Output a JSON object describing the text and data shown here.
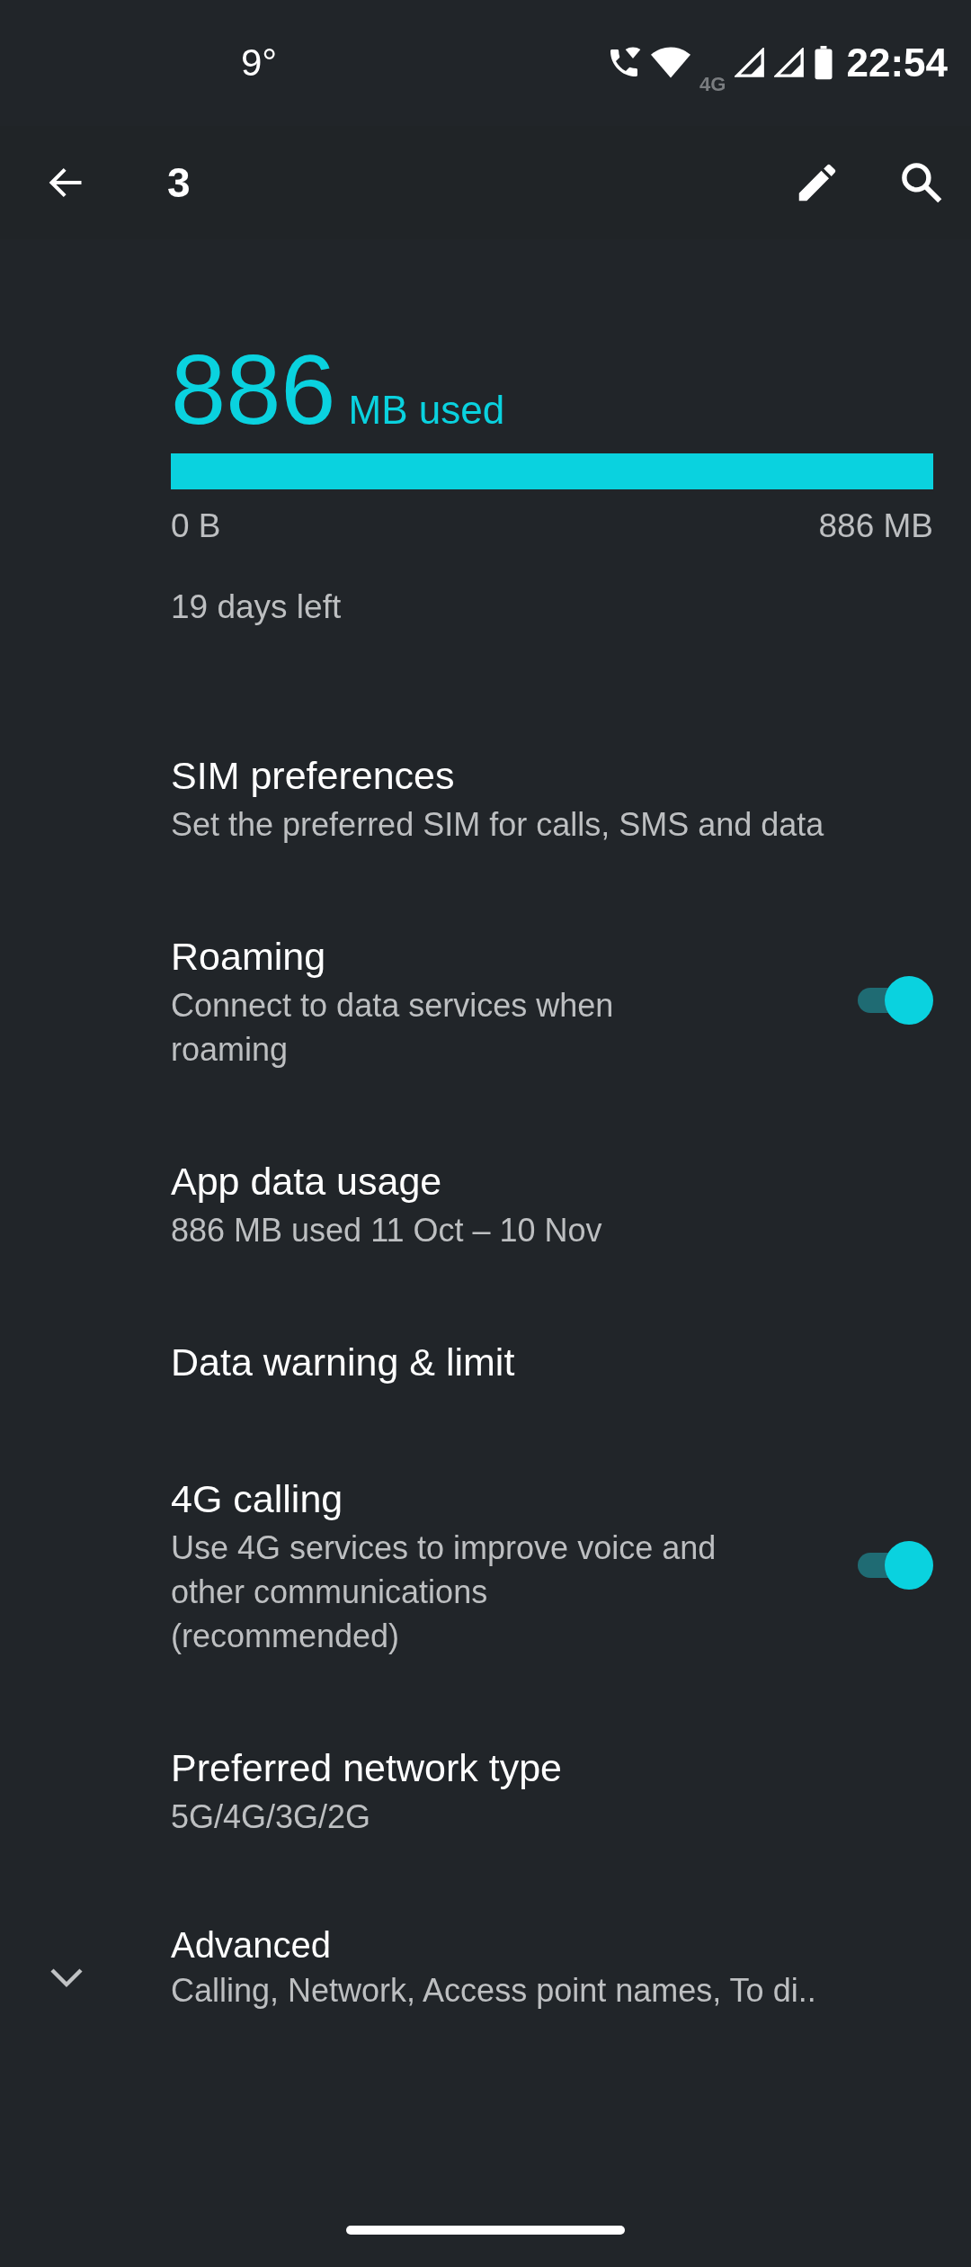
{
  "status_bar": {
    "weather": "9°",
    "network_label": "4G",
    "time": "22:54"
  },
  "app_bar": {
    "title": "3"
  },
  "usage": {
    "amount": "886",
    "unit": "MB used",
    "level": 1,
    "min_label": "0 B",
    "max_label": "886 MB",
    "days_left": "19 days left"
  },
  "settings": [
    {
      "kind": "plain",
      "title": "SIM preferences",
      "summary": "Set the preferred SIM for calls, SMS and data"
    },
    {
      "kind": "toggle",
      "title": "Roaming",
      "summary": "Connect to data services when roaming",
      "on": true
    },
    {
      "kind": "plain",
      "title": "App data usage",
      "summary": "886 MB used 11 Oct – 10 Nov"
    },
    {
      "kind": "plain",
      "title": "Data warning & limit"
    },
    {
      "kind": "toggle",
      "title": "4G calling",
      "summary": "Use 4G services to improve voice and other communications (recommended)",
      "on": true
    },
    {
      "kind": "plain",
      "title": "Preferred network type",
      "summary": "5G/4G/3G/2G"
    },
    {
      "kind": "expand",
      "title": "Advanced",
      "summary": "Calling, Network, Access point names, To di..",
      "expanded": false
    }
  ]
}
